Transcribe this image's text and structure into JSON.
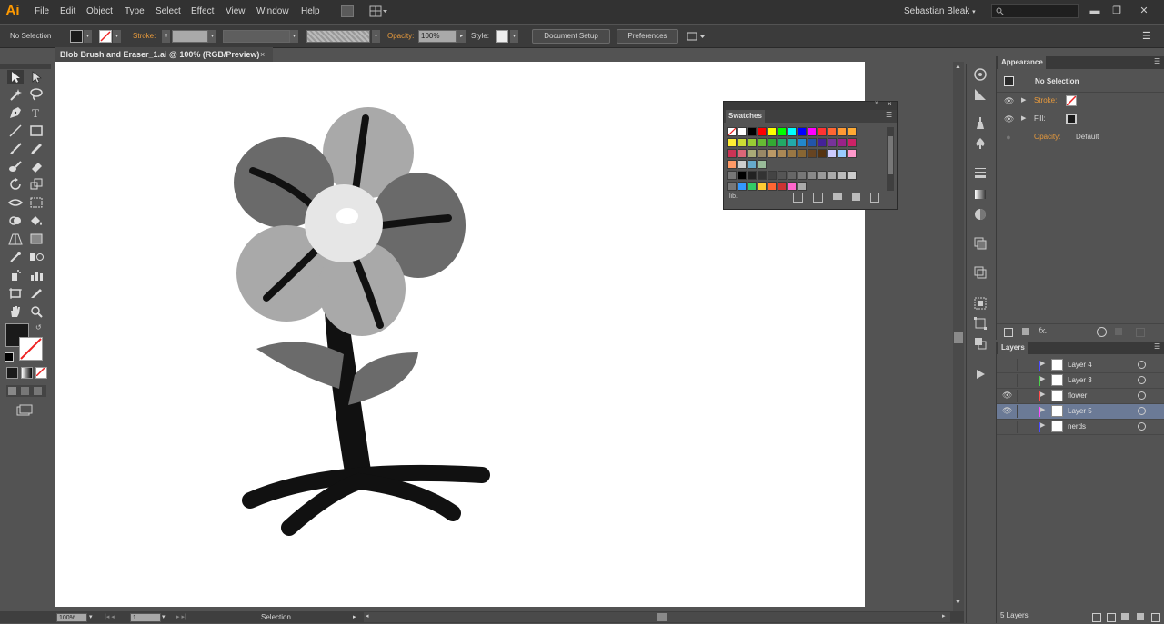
{
  "app": {
    "logo": "Ai",
    "user": "Sebastian Bleak",
    "user_arrow": "▾"
  },
  "menu": [
    "File",
    "Edit",
    "Object",
    "Type",
    "Select",
    "Effect",
    "View",
    "Window",
    "Help"
  ],
  "window_controls": {
    "minimize": "▬",
    "restore": "❐",
    "close": "✕"
  },
  "controlbar": {
    "selection_label": "No Selection",
    "stroke_label": "Stroke:",
    "opacity_label": "Opacity:",
    "opacity_value": "100%",
    "style_label": "Style:",
    "document_setup": "Document Setup",
    "preferences": "Preferences",
    "menu_icon": "☰"
  },
  "document": {
    "tab_title": "Blob Brush and Eraser_1.ai @ 100% (RGB/Preview)",
    "tab_close": "×"
  },
  "status": {
    "zoom": "100%",
    "page": "1",
    "tool": "Selection"
  },
  "appearance": {
    "tab": "Appearance",
    "title": "No Selection",
    "stroke_label": "Stroke:",
    "fill_label": "Fill:",
    "opacity_label": "Opacity:",
    "opacity_value": "Default",
    "fx_label": "fx."
  },
  "swatches": {
    "tab": "Swatches",
    "lib_label": "lib."
  },
  "layers": {
    "tab": "Layers",
    "count": "5 Layers",
    "items": [
      {
        "name": "Layer 4",
        "color": "#4b4bff",
        "visible": false,
        "selected": false
      },
      {
        "name": "Layer 3",
        "color": "#4bd24b",
        "visible": false,
        "selected": false
      },
      {
        "name": "flower",
        "color": "#ff4b4b",
        "visible": true,
        "selected": false
      },
      {
        "name": "Layer 5",
        "color": "#ff4bff",
        "visible": true,
        "selected": true
      },
      {
        "name": "nerds",
        "color": "#4b4bff",
        "visible": false,
        "selected": false
      }
    ]
  },
  "colors": {
    "accent": "#ff9a00",
    "panel": "#535353",
    "selected_layer": "#6b7a96",
    "petal_dark": "#6a6a6a",
    "petal_mid": "#a9a9a9",
    "center": "#e6e6e6",
    "leaf": "#6b6b6b",
    "stem": "#111111"
  },
  "swatch_colors": [
    [
      "#ffffff",
      "#ffffff",
      "#000000",
      "#ff0000",
      "#ffff00",
      "#00ff00",
      "#00ffff",
      "#0000ff",
      "#ff00ff",
      "#ff3333",
      "#ff6633",
      "#ff9933",
      "#ffaa33"
    ],
    [
      "#ffee33",
      "#ccdd33",
      "#99cc33",
      "#66bb33",
      "#33aa33",
      "#22aa66",
      "#22aaaa",
      "#2288cc",
      "#2255aa",
      "#442299",
      "#773399",
      "#992288",
      "#cc2266"
    ],
    [
      "#cc3355",
      "#dd6677",
      "#aaaa77",
      "#998866",
      "#bb9966",
      "#aa8855",
      "#997744",
      "#886633",
      "#664422",
      "#553311",
      "#ccccff",
      "#99ccff",
      "#ff99cc"
    ],
    [
      "#ff9966",
      "#cccccc",
      "#66aacc",
      "#99bb99"
    ],
    [
      "#000000",
      "#222222",
      "#333333",
      "#444444",
      "#555555",
      "#666666",
      "#777777",
      "#888888",
      "#999999",
      "#aaaaaa",
      "#bbbbbb",
      "#cccccc"
    ],
    [
      "#3399ff",
      "#33cc66",
      "#ffcc33",
      "#ff6633",
      "#cc3333",
      "#ff66cc",
      "#aaaaaa"
    ]
  ]
}
